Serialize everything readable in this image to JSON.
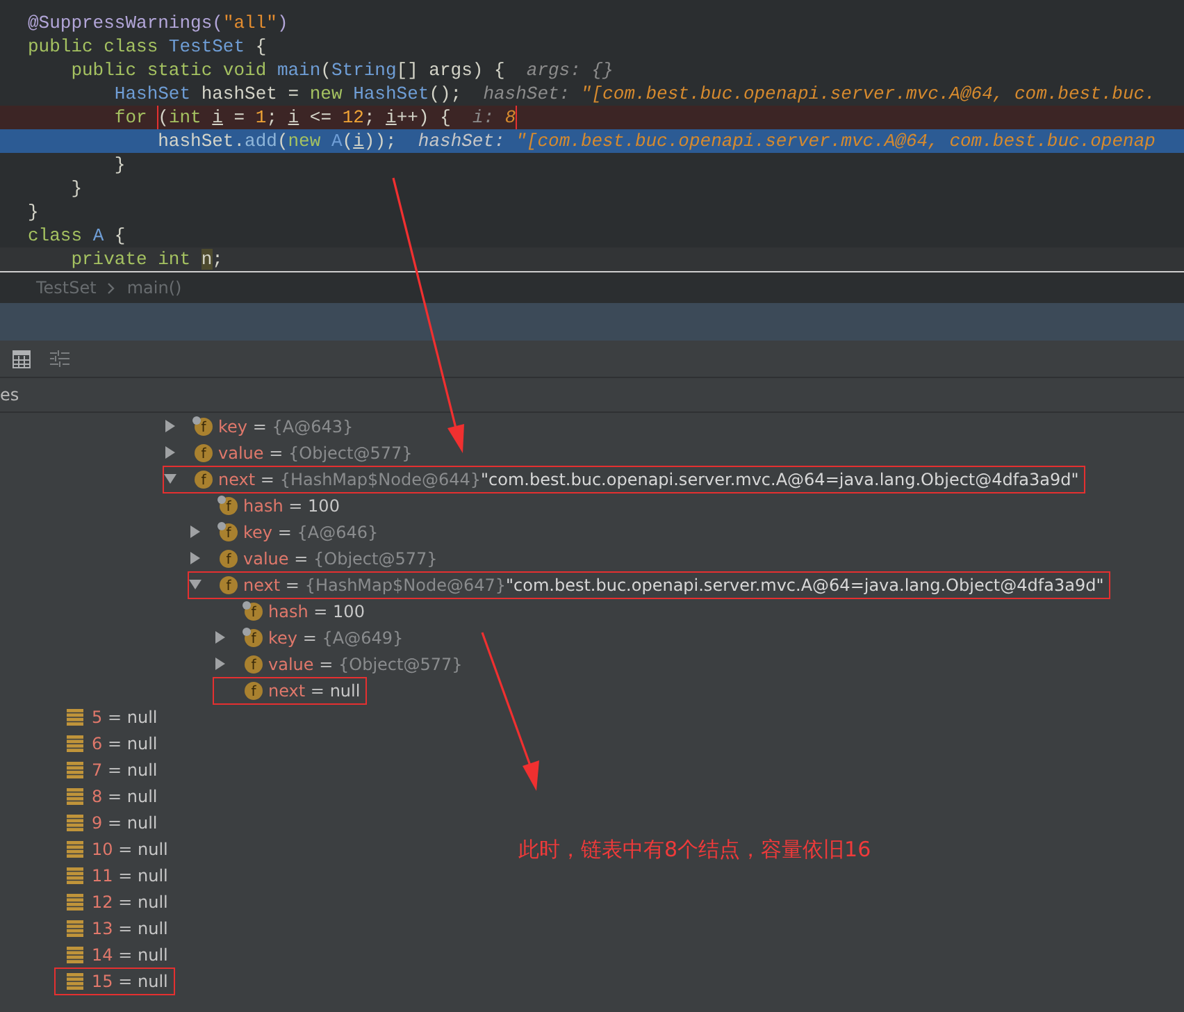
{
  "editor": {
    "lines": [
      {
        "kind": "normal",
        "segments": [
          {
            "text": "@SuppressWarnings(",
            "kind": "ann"
          },
          {
            "text": "\"all\"",
            "kind": "str"
          },
          {
            "text": ")",
            "kind": "ann"
          }
        ]
      },
      {
        "kind": "normal",
        "segments": [
          {
            "text": "public class ",
            "kind": "kw"
          },
          {
            "text": "TestSet",
            "kind": "type"
          },
          {
            "text": " {",
            "kind": "plain"
          }
        ]
      },
      {
        "kind": "normal",
        "segments": [
          {
            "text": "    public static void ",
            "kind": "kw"
          },
          {
            "text": "main",
            "kind": "type"
          },
          {
            "text": "(",
            "kind": "plain"
          },
          {
            "text": "String",
            "kind": "type"
          },
          {
            "text": "[] args) {  ",
            "kind": "plain"
          },
          {
            "text": "args: {}",
            "kind": "hint"
          }
        ]
      },
      {
        "kind": "normal",
        "segments": [
          {
            "text": "        HashSet",
            "kind": "type"
          },
          {
            "text": " hashSet = ",
            "kind": "plain"
          },
          {
            "text": "new ",
            "kind": "kw"
          },
          {
            "text": "HashSet",
            "kind": "type"
          },
          {
            "text": "();  ",
            "kind": "plain"
          },
          {
            "text": "hashSet: ",
            "kind": "hint"
          },
          {
            "text": "\"[com.best.buc.openapi.server.mvc.A@64, com.best.buc.",
            "kind": "hintval"
          }
        ]
      },
      {
        "kind": "breakpoint",
        "segments": [
          {
            "text": "        for ",
            "kind": "kw"
          }
        ],
        "boxed": [
          {
            "text": "(",
            "kind": "plain"
          },
          {
            "text": "int ",
            "kind": "kw"
          },
          {
            "text": "i",
            "kind": "var"
          },
          {
            "text": " = ",
            "kind": "plain"
          },
          {
            "text": "1",
            "kind": "num"
          },
          {
            "text": "; ",
            "kind": "plain"
          },
          {
            "text": "i",
            "kind": "var"
          },
          {
            "text": " <= ",
            "kind": "plain"
          },
          {
            "text": "12",
            "kind": "num"
          },
          {
            "text": "; ",
            "kind": "plain"
          },
          {
            "text": "i",
            "kind": "var"
          },
          {
            "text": "++) {  ",
            "kind": "plain"
          },
          {
            "text": "i: ",
            "kind": "hint"
          },
          {
            "text": "8",
            "kind": "hintval"
          }
        ]
      },
      {
        "kind": "current",
        "segments": [
          {
            "text": "            hashSet.",
            "kind": "plain"
          },
          {
            "text": "add",
            "kind": "method"
          },
          {
            "text": "(",
            "kind": "plain"
          },
          {
            "text": "new ",
            "kind": "kw"
          },
          {
            "text": "A",
            "kind": "type"
          },
          {
            "text": "(",
            "kind": "plain"
          },
          {
            "text": "i",
            "kind": "var"
          },
          {
            "text": "));  ",
            "kind": "plain"
          },
          {
            "text": "hashSet: ",
            "kind": "hint"
          },
          {
            "text": "\"[com.best.buc.openapi.server.mvc.A@64, com.best.buc.openap",
            "kind": "hintval"
          }
        ]
      },
      {
        "kind": "normal",
        "segments": [
          {
            "text": "        }",
            "kind": "plain"
          }
        ]
      },
      {
        "kind": "normal",
        "segments": [
          {
            "text": "    }",
            "kind": "plain"
          }
        ]
      },
      {
        "kind": "normal",
        "segments": [
          {
            "text": "}",
            "kind": "plain"
          }
        ]
      },
      {
        "kind": "normal",
        "segments": [
          {
            "text": "class ",
            "kind": "kw"
          },
          {
            "text": "A",
            "kind": "type"
          },
          {
            "text": " {",
            "kind": "plain"
          }
        ]
      },
      {
        "kind": "caret",
        "segments": [
          {
            "text": "    private int ",
            "kind": "kw"
          },
          {
            "text": "n",
            "kind": "field"
          },
          {
            "text": ";",
            "kind": "plain"
          }
        ]
      }
    ]
  },
  "breadcrumb": [
    "TestSet",
    "main()"
  ],
  "debugger": {
    "tab_fragment": "es",
    "field_rows": [
      {
        "icon": "f",
        "name": "key",
        "sep": "=",
        "value": "{A@643}",
        "kind": "ref",
        "final": true,
        "expanded": false,
        "boxed": false
      },
      {
        "icon": "f",
        "name": "value",
        "sep": "=",
        "value": "{Object@577}",
        "kind": "ref",
        "final": false,
        "expanded": false,
        "boxed": false
      },
      {
        "icon": "f",
        "name": "next",
        "sep": "=",
        "value": "{HashMap$Node@644}",
        "string": "\"com.best.buc.openapi.server.mvc.A@64=java.lang.Object@4dfa3a9d\"",
        "kind": "ref",
        "final": false,
        "expanded": true,
        "boxed": true,
        "children": [
          {
            "icon": "f",
            "name": "hash",
            "sep": "=",
            "value": "100",
            "kind": "primitive",
            "final": true,
            "boxed": false
          },
          {
            "icon": "f",
            "name": "key",
            "sep": "=",
            "value": "{A@646}",
            "kind": "ref",
            "final": true,
            "expanded": false,
            "boxed": false
          },
          {
            "icon": "f",
            "name": "value",
            "sep": "=",
            "value": "{Object@577}",
            "kind": "ref",
            "final": false,
            "expanded": false,
            "boxed": false
          },
          {
            "icon": "f",
            "name": "next",
            "sep": "=",
            "value": "{HashMap$Node@647}",
            "string": "\"com.best.buc.openapi.server.mvc.A@64=java.lang.Object@4dfa3a9d\"",
            "kind": "ref",
            "final": false,
            "expanded": true,
            "boxed": true,
            "children": [
              {
                "icon": "f",
                "name": "hash",
                "sep": "=",
                "value": "100",
                "kind": "primitive",
                "final": true,
                "boxed": false
              },
              {
                "icon": "f",
                "name": "key",
                "sep": "=",
                "value": "{A@649}",
                "kind": "ref",
                "final": true,
                "expanded": false,
                "boxed": false
              },
              {
                "icon": "f",
                "name": "value",
                "sep": "=",
                "value": "{Object@577}",
                "kind": "ref",
                "final": false,
                "expanded": false,
                "boxed": false
              },
              {
                "icon": "f",
                "name": "next",
                "sep": "=",
                "value": "null",
                "kind": "primitive",
                "final": false,
                "boxed": true
              }
            ]
          }
        ]
      }
    ],
    "table_entries": [
      {
        "index": "5",
        "sep": "=",
        "value": "null",
        "boxed": false
      },
      {
        "index": "6",
        "sep": "=",
        "value": "null",
        "boxed": false
      },
      {
        "index": "7",
        "sep": "=",
        "value": "null",
        "boxed": false
      },
      {
        "index": "8",
        "sep": "=",
        "value": "null",
        "boxed": false
      },
      {
        "index": "9",
        "sep": "=",
        "value": "null",
        "boxed": false
      },
      {
        "index": "10",
        "sep": "=",
        "value": "null",
        "boxed": false
      },
      {
        "index": "11",
        "sep": "=",
        "value": "null",
        "boxed": false
      },
      {
        "index": "12",
        "sep": "=",
        "value": "null",
        "boxed": false
      },
      {
        "index": "13",
        "sep": "=",
        "value": "null",
        "boxed": false
      },
      {
        "index": "14",
        "sep": "=",
        "value": "null",
        "boxed": false
      },
      {
        "index": "15",
        "sep": "=",
        "value": "null",
        "boxed": true
      }
    ]
  },
  "note": "此时，链表中有8个结点，容量依旧16"
}
